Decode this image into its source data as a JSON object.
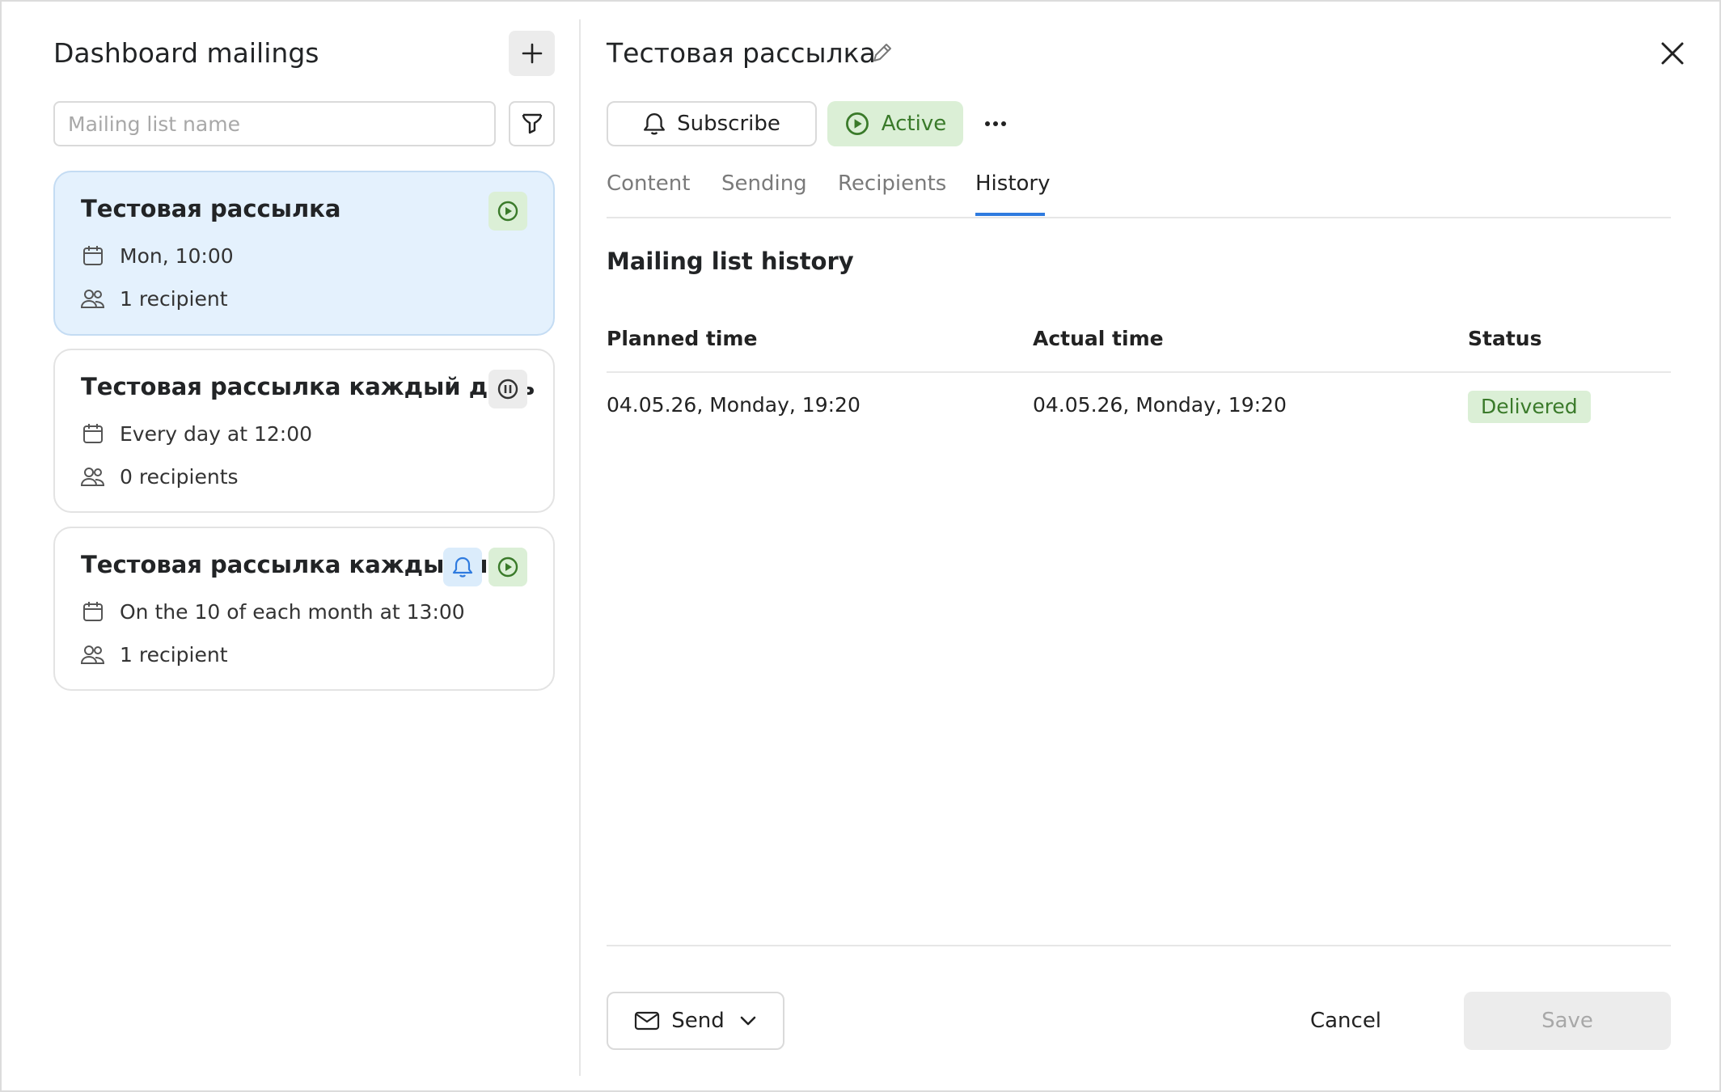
{
  "left": {
    "title": "Dashboard mailings",
    "search_placeholder": "Mailing list name",
    "cards": [
      {
        "title": "Тестовая рассылка",
        "schedule": "Mon, 10:00",
        "recipients": "1 recipient",
        "state": "active"
      },
      {
        "title": "Тестовая рассылка каждый день",
        "schedule": "Every day at 12:00",
        "recipients": "0 recipients",
        "state": "paused"
      },
      {
        "title": "Тестовая рассылка каждый м...",
        "schedule": "On the 10 of each month at 13:00",
        "recipients": "1 recipient",
        "state": "active-subscribed"
      }
    ]
  },
  "detail": {
    "title": "Тестовая рассылка",
    "subscribe_label": "Subscribe",
    "active_label": "Active",
    "tabs": [
      "Content",
      "Sending",
      "Recipients",
      "History"
    ],
    "active_tab": "History",
    "section_title": "Mailing list history",
    "columns": [
      "Planned time",
      "Actual time",
      "Status"
    ],
    "rows": [
      {
        "planned": "04.05.26, Monday, 19:20",
        "actual": "04.05.26, Monday, 19:20",
        "status": "Delivered"
      }
    ],
    "send_label": "Send",
    "cancel_label": "Cancel",
    "save_label": "Save"
  },
  "colors": {
    "accent_blue": "#2f7bdf",
    "active_green": "#3a7a2a",
    "active_bg": "#dbefd6",
    "selected_card_bg": "#e4f1fd"
  }
}
